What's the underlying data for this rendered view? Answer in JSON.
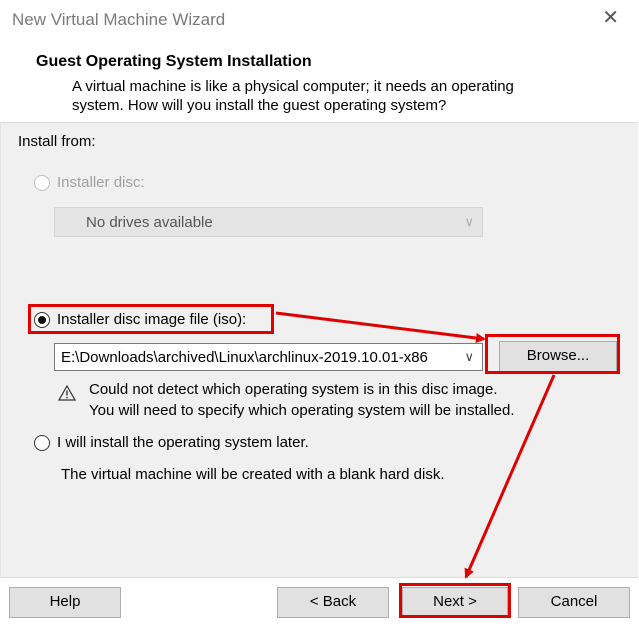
{
  "window": {
    "title": "New Virtual Machine Wizard",
    "close_glyph": "✕"
  },
  "header": {
    "title": "Guest Operating System Installation",
    "desc_line1": "A virtual machine is like a physical computer; it needs an operating",
    "desc_line2": "system. How will you install the guest operating system?"
  },
  "install_from": {
    "label": "Install from:",
    "disc": {
      "label": "Installer disc:",
      "dropdown_value": "No drives available",
      "selected": false,
      "enabled": false
    },
    "iso": {
      "label": "Installer disc image file (iso):",
      "path_value": "E:\\Downloads\\archived\\Linux\\archlinux-2019.10.01-x86",
      "browse_label": "Browse...",
      "selected": true,
      "warning_line1": "Could not detect which operating system is in this disc image.",
      "warning_line2": "You will need to specify which operating system will be installed."
    },
    "later": {
      "label": "I will install the operating system later.",
      "note": "The virtual machine will be created with a blank hard disk.",
      "selected": false
    }
  },
  "footer": {
    "help": "Help",
    "back": "< Back",
    "next": "Next >",
    "cancel": "Cancel"
  },
  "annotation_color": "#e00000"
}
